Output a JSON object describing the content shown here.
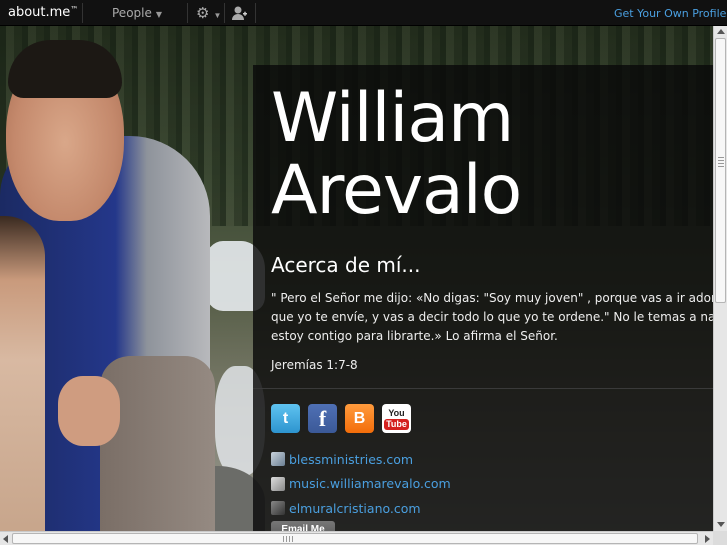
{
  "topbar": {
    "logo_text": "about.me",
    "logo_tm": "™",
    "people_label": "People",
    "get_own_profile": "Get Your Own Profile"
  },
  "profile": {
    "first_name": "William",
    "last_name": "Arevalo",
    "about_heading": "Acerca de mí...",
    "bio_lines": [
      "\" Pero el Señor me dijo:     «No digas: \"Soy muy joven\" , porque vas a ir adonde",
      "que yo te envíe, y vas a decir todo lo que yo te ordene.\" No le temas a nadie,",
      "estoy contigo para librarte.» Lo afirma el Señor."
    ],
    "verse": "Jeremías 1:7-8",
    "social": {
      "twitter_glyph": "t",
      "facebook_glyph": "f",
      "blogger_glyph": "B",
      "youtube_you": "You",
      "youtube_tube": "Tube"
    },
    "links": [
      "blessministries.com",
      "music.williamarevalo.com",
      "elmuralcristiano.com"
    ],
    "email_button": "Email Me"
  },
  "icons": {
    "gear": "gear-icon",
    "person": "person-add-icon",
    "caret": "chevron-down-icon"
  },
  "colors": {
    "topbar_bg": "#111111",
    "link": "#4a9fe0",
    "panel_bg": "rgba(10,10,10,0.82)"
  }
}
